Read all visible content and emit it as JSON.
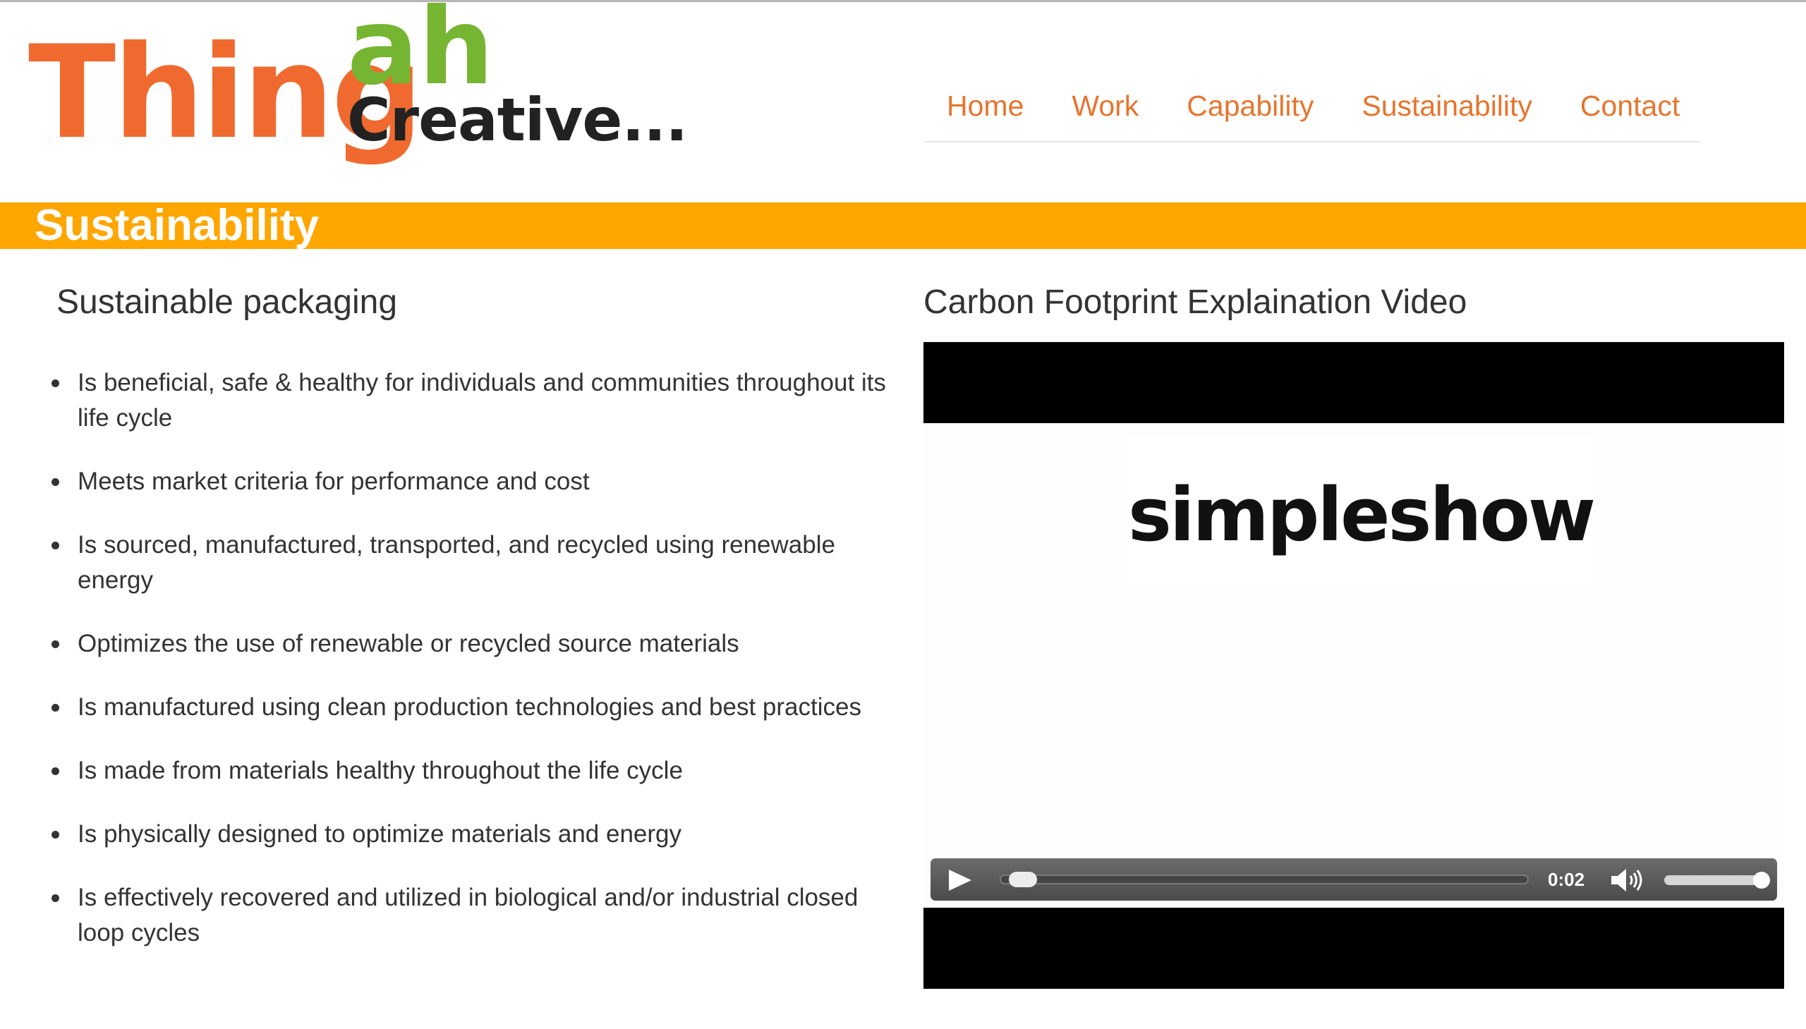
{
  "logo": {
    "part1": "Thing",
    "part2": "ah",
    "part3": "Creative..."
  },
  "nav": {
    "items": [
      "Home",
      "Work",
      "Capability",
      "Sustainability",
      "Contact"
    ]
  },
  "page": {
    "banner_title": "Sustainability"
  },
  "packaging": {
    "heading": "Sustainable packaging",
    "items": [
      "Is beneficial, safe & healthy for individuals and communities throughout its life cycle",
      "Meets market criteria for performance and cost",
      "Is sourced, manufactured, transported, and recycled using renewable energy",
      "Optimizes the use of renewable or recycled source materials",
      "Is manufactured using clean production technologies and best practices",
      "Is made from materials healthy throughout the life cycle",
      "Is physically designed to optimize materials and energy",
      "Is effectively recovered and utilized in biological and/or industrial closed loop cycles"
    ]
  },
  "video": {
    "heading": "Carbon Footprint Explaination Video",
    "logo_text": "simpleshow",
    "time": "0:02",
    "progress_fraction": 0.01,
    "volume_fraction": 1.0
  },
  "colors": {
    "accent_orange": "#ffa600",
    "nav_link": "#e6752e",
    "logo_orange": "#f06a2f",
    "logo_green": "#76b531"
  }
}
